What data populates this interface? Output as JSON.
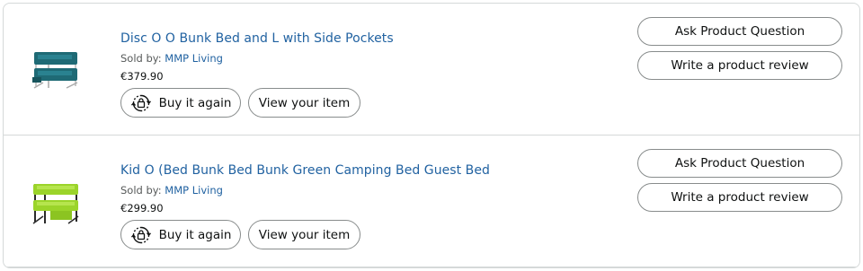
{
  "orders": [
    {
      "title": "Disc O O Bunk Bed and L with Side Pockets",
      "sold_by_label": "Sold by:",
      "seller": "MMP Living",
      "price": "€379.90",
      "image_icon": "teal-bunk-bed-image",
      "colors": {
        "bed": "#1f6a75",
        "frame": "#cfcfcf"
      },
      "buttons": {
        "buy_again": "Buy it again",
        "view_item": "View your item",
        "ask_question": "Ask Product Question",
        "write_review": "Write a product review"
      }
    },
    {
      "title": "Kid O (Bed Bunk Bed Bunk Green Camping Bed Guest Bed",
      "sold_by_label": "Sold by:",
      "seller": "MMP Living",
      "price": "€299.90",
      "image_icon": "green-bunk-bed-image",
      "colors": {
        "bed": "#9bd42a",
        "frame": "#2b2b2b"
      },
      "buttons": {
        "buy_again": "Buy it again",
        "view_item": "View your item",
        "ask_question": "Ask Product Question",
        "write_review": "Write a product review"
      }
    }
  ],
  "icons": {
    "buy_again": "reorder-cycle-icon"
  },
  "colors": {
    "link": "#2162a1",
    "border": "#d5d9d9",
    "button_border": "#888c8c"
  }
}
